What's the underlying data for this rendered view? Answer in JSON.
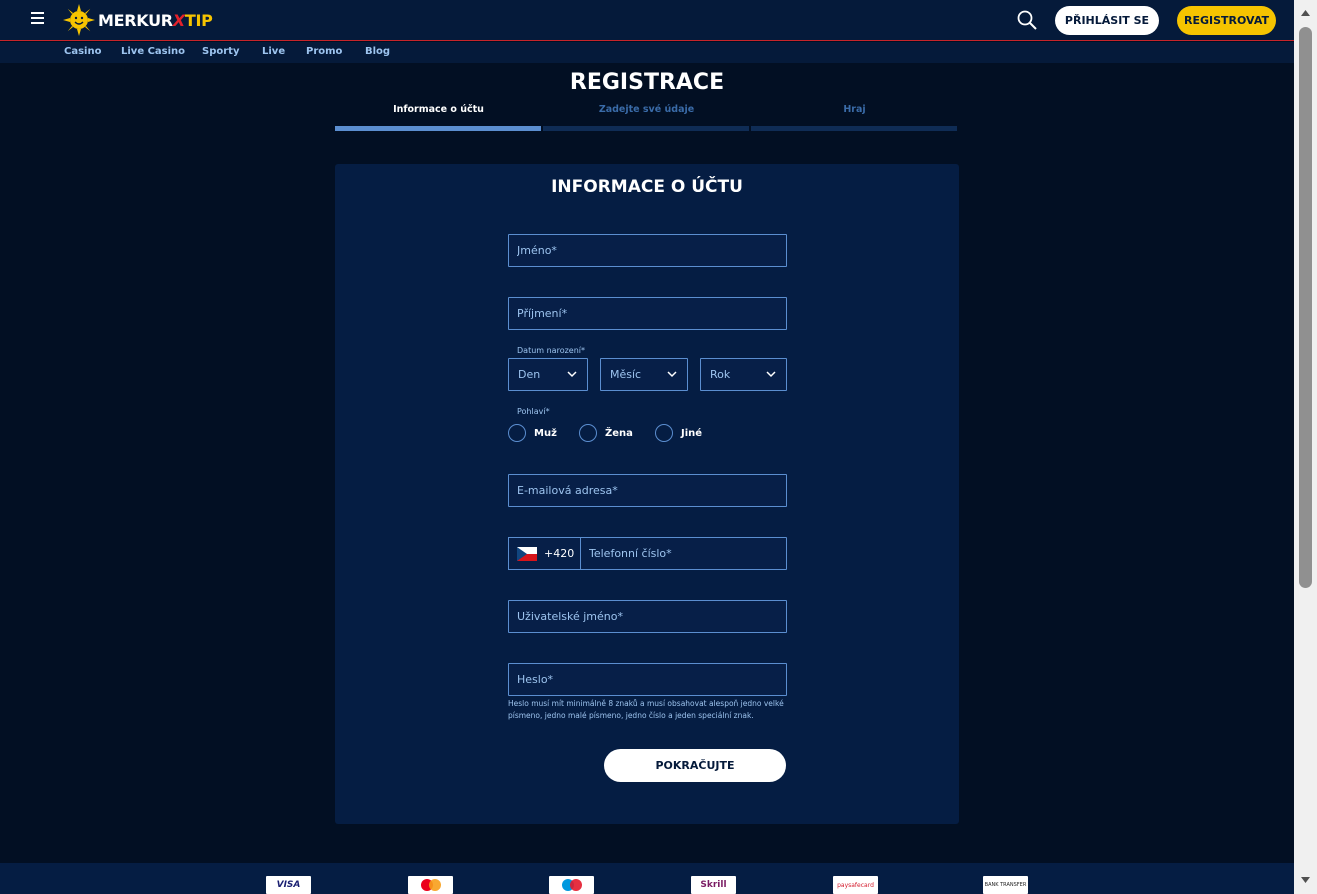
{
  "header": {
    "logo": {
      "part1": "MERKUR",
      "part2": "X",
      "part3": "TIP"
    },
    "login_label": "PŘIHLÁSIT SE",
    "register_label": "REGISTROVAT"
  },
  "nav": {
    "items": [
      {
        "label": "Casino"
      },
      {
        "label": "Live Casino"
      },
      {
        "label": "Sporty"
      },
      {
        "label": "Live"
      },
      {
        "label": "Promo"
      },
      {
        "label": "Blog"
      }
    ]
  },
  "page_title": "REGISTRACE",
  "steps": [
    {
      "label": "Informace o účtu",
      "active": true
    },
    {
      "label": "Zadejte své údaje",
      "active": false
    },
    {
      "label": "Hraj",
      "active": false
    }
  ],
  "form": {
    "title": "INFORMACE O ÚČTU",
    "first_name_placeholder": "Jméno*",
    "last_name_placeholder": "Příjmení*",
    "dob_label": "Datum narození*",
    "dob_day": "Den",
    "dob_month": "Měsíc",
    "dob_year": "Rok",
    "gender_label": "Pohlaví*",
    "gender_options": [
      "Muž",
      "Žena",
      "Jiné"
    ],
    "email_placeholder": "E-mailová adresa*",
    "phone_prefix": "+420",
    "phone_placeholder": "Telefonní číslo*",
    "username_placeholder": "Uživatelské jméno*",
    "password_placeholder": "Heslo*",
    "password_hint": "Heslo musí mít minimálně 8 znaků a musí obsahovat alespoň jedno velké písmeno, jedno malé písmeno, jedno číslo a jeden speciální znak.",
    "continue_label": "POKRAČUJTE"
  },
  "payments": [
    {
      "label": "VISA"
    },
    {
      "label": "mastercard"
    },
    {
      "label": "maestro"
    },
    {
      "label": "Skrill"
    },
    {
      "label": "paysafecard"
    },
    {
      "label": "BANK TRANSFER"
    }
  ],
  "colors": {
    "background": "#020f23",
    "header": "#051a3a",
    "card": "#051d43",
    "accent": "#5b8ed0",
    "brand_yellow": "#f6c400",
    "brand_red": "#e3212b"
  }
}
